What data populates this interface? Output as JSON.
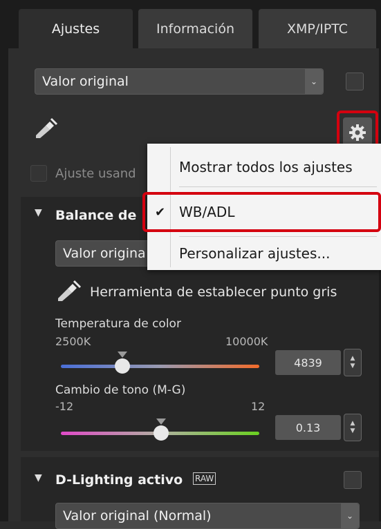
{
  "tabs": [
    {
      "label": "Ajustes",
      "active": true
    },
    {
      "label": "Información",
      "active": false
    },
    {
      "label": "XMP/IPTC",
      "active": false
    }
  ],
  "preset_select": {
    "value": "Valor original"
  },
  "adjust_using_label": "Ajuste usand",
  "settings_menu": {
    "items": [
      {
        "label": "Mostrar todos los ajustes",
        "checked": false
      },
      {
        "label": "WB/ADL",
        "checked": true
      },
      {
        "label": "Personalizar ajustes..."
      }
    ]
  },
  "white_balance": {
    "title": "Balance de",
    "select_value": "Valor origina",
    "gray_point_label": "Herramienta de establecer punto gris",
    "temperature": {
      "label": "Temperatura de color",
      "min": "2500K",
      "max": "10000K",
      "value": "4839",
      "fraction": 0.31
    },
    "tint": {
      "label": "Cambio de tono (M-G)",
      "min": "-12",
      "max": "12",
      "value": "0.13",
      "fraction": 0.505
    }
  },
  "active_d_lighting": {
    "title": "D-Lighting activo",
    "raw_badge": "RAW",
    "select_value": "Valor original (Normal)"
  },
  "colors": {
    "highlight": "#d4000f",
    "menu_bg": "#f4f4f4",
    "panel_bg": "#2e2e2e"
  }
}
